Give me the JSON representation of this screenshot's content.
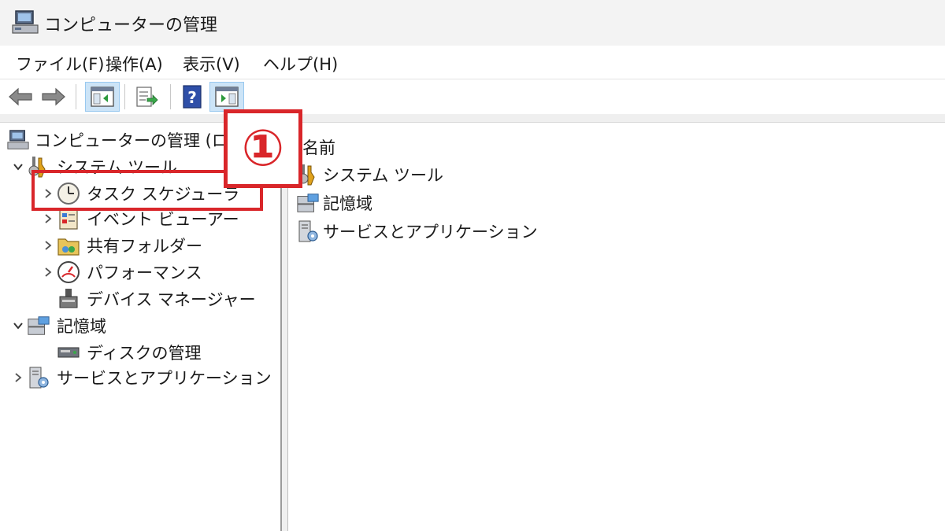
{
  "window": {
    "title": "コンピューターの管理"
  },
  "menu": [
    "ファイル(F)",
    "操作(A)",
    "表示(V)",
    "ヘルプ(H)"
  ],
  "toolbar": {
    "buttons": [
      "back-arrow-icon",
      "forward-arrow-icon",
      "show-hide-tree-icon",
      "export-list-icon",
      "help-icon",
      "show-hide-action-pane-icon"
    ]
  },
  "tree": {
    "root": "コンピューターの管理 (ローカル",
    "system_tools": "システム ツール",
    "task_scheduler": "タスク スケジューラ",
    "event_viewer": "イベント ビューアー",
    "shared_folders": "共有フォルダー",
    "performance": "パフォーマンス",
    "device_manager": "デバイス マネージャー",
    "storage": "記憶域",
    "disk_management": "ディスクの管理",
    "services_apps": "サービスとアプリケーション"
  },
  "list": {
    "header": "名前",
    "items": [
      "システム ツール",
      "記憶域",
      "サービスとアプリケーション"
    ]
  },
  "annotation": {
    "badge": "①"
  },
  "colors": {
    "annotation_red": "#d9262a",
    "selected_button": "#cce4f7"
  }
}
